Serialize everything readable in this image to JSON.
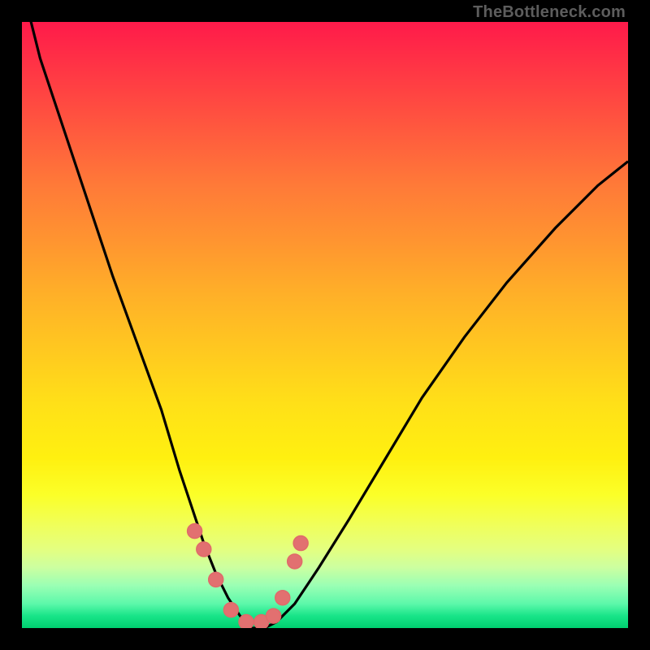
{
  "watermark": "TheBottleneck.com",
  "colors": {
    "frame": "#000000",
    "curve_stroke": "#000000",
    "marker_stroke": "#e06a6a",
    "marker_fill": "#e27070"
  },
  "chart_data": {
    "type": "line",
    "title": "",
    "xlabel": "",
    "ylabel": "",
    "xlim": [
      0,
      100
    ],
    "ylim": [
      0,
      100
    ],
    "grid": false,
    "series": [
      {
        "name": "bottleneck-curve",
        "x": [
          0,
          3,
          7,
          11,
          15,
          19,
          23,
          26,
          28,
          30,
          32,
          34,
          36,
          38,
          40,
          42,
          45,
          49,
          54,
          60,
          66,
          73,
          80,
          88,
          95,
          100
        ],
        "y": [
          106,
          94,
          82,
          70,
          58,
          47,
          36,
          26,
          20,
          14,
          9,
          5,
          2,
          0,
          0,
          1,
          4,
          10,
          18,
          28,
          38,
          48,
          57,
          66,
          73,
          77
        ]
      }
    ],
    "markers": [
      {
        "x": 28.5,
        "y": 16
      },
      {
        "x": 30.0,
        "y": 13
      },
      {
        "x": 32.0,
        "y": 8
      },
      {
        "x": 34.5,
        "y": 3
      },
      {
        "x": 37.0,
        "y": 1
      },
      {
        "x": 39.5,
        "y": 1
      },
      {
        "x": 41.5,
        "y": 2
      },
      {
        "x": 43.0,
        "y": 5
      },
      {
        "x": 45.0,
        "y": 11
      },
      {
        "x": 46.0,
        "y": 14
      }
    ],
    "marker_radius_px": 9
  }
}
